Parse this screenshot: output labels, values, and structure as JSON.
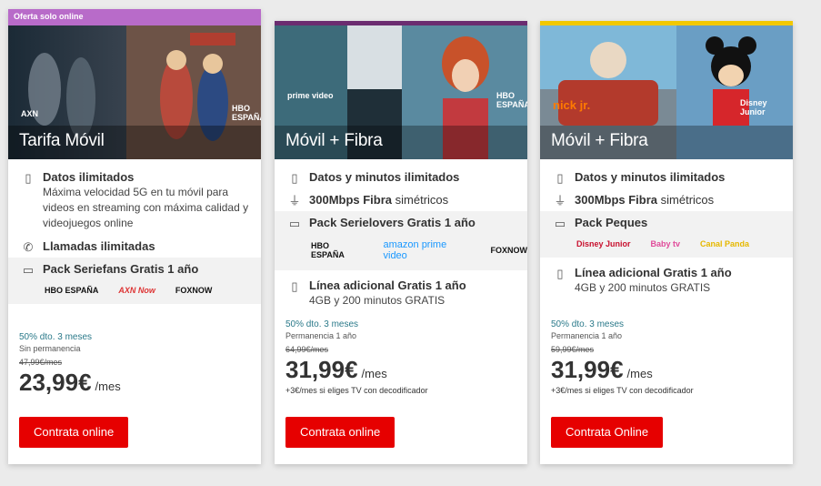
{
  "cards": [
    {
      "badge": "Oferta solo online",
      "title": "Tarifa Móvil",
      "hero_logos": [
        "AXN",
        "HBO ESPAÑA"
      ],
      "accent": "#b86bc9",
      "features": [
        {
          "icon": "phone-icon",
          "title": "Datos ilimitados",
          "desc": "Máxima velocidad 5G en tu móvil para videos en streaming con máxima calidad y videojuegos online"
        },
        {
          "icon": "call-icon",
          "title": "Llamadas ilimitadas"
        }
      ],
      "pack": {
        "icon": "tv-icon",
        "title": "Pack Seriefans Gratis 1 año",
        "logos": [
          "HBO ESPAÑA",
          "AXN Now",
          "FOXNOW"
        ]
      },
      "promo": "50% dto. 3 meses",
      "perm": "Sin permanencia",
      "old_price": "47,99€/mes",
      "price": "23,99€",
      "per": "/mes",
      "cta": "Contrata online"
    },
    {
      "title": "Móvil + Fibra",
      "hero_logos": [
        "prime video",
        "HBO ESPAÑA"
      ],
      "accent": "#6b2c70",
      "features": [
        {
          "icon": "phone-icon",
          "title": "Datos y minutos ilimitados"
        },
        {
          "icon": "router-icon",
          "title": "300Mbps Fibra",
          "title_reg": " simétricos"
        }
      ],
      "pack": {
        "icon": "tv-icon",
        "title": "Pack Serielovers Gratis 1 año",
        "logos": [
          "HBO ESPAÑA",
          "amazon prime video",
          "FOXNOW"
        ]
      },
      "extra_line": {
        "icon": "sim-icon",
        "title": "Línea adicional Gratis 1 año",
        "desc": "4GB y 200 minutos GRATIS"
      },
      "promo": "50% dto. 3 meses",
      "perm": "Permanencia 1 año",
      "old_price": "64,99€/mes",
      "price": "31,99€",
      "per": "/mes",
      "note": "+3€/mes si eliges TV con decodificador",
      "cta": "Contrata online"
    },
    {
      "title": "Móvil + Fibra",
      "hero_logos": [
        "nick jr.",
        "Disney Junior"
      ],
      "accent": "#f2c800",
      "features": [
        {
          "icon": "phone-icon",
          "title": "Datos y minutos ilimitados"
        },
        {
          "icon": "router-icon",
          "title": "300Mbps Fibra",
          "title_reg": " simétricos"
        }
      ],
      "pack": {
        "icon": "tv-icon",
        "title": "Pack Peques",
        "logos": [
          "Disney Junior",
          "Baby tv",
          "Canal Panda"
        ]
      },
      "extra_line": {
        "icon": "sim-icon",
        "title": "Línea adicional Gratis 1 año",
        "desc": "4GB y 200 minutos GRATIS"
      },
      "promo": "50% dto. 3 meses",
      "perm": "Permanencia 1 año",
      "old_price": "59,99€/mes",
      "price": "31,99€",
      "per": "/mes",
      "note": "+3€/mes si eliges TV con decodificador",
      "cta": "Contrata Online"
    }
  ]
}
